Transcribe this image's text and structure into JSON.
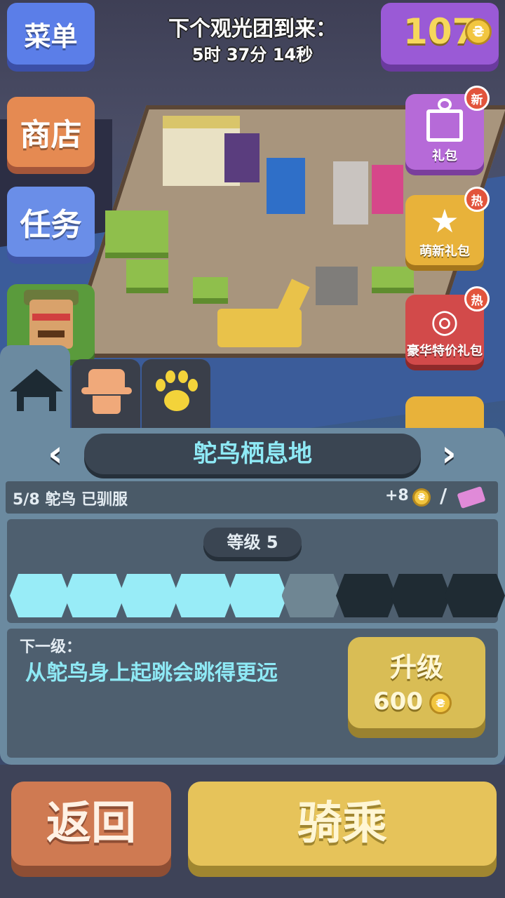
{
  "hud": {
    "menu_label": "菜单",
    "shop_label": "商店",
    "tasks_label": "任务",
    "tour_title": "下个观光团到来：",
    "tour_countdown": "5时 37分 14秒",
    "coins": "107",
    "coin_symbol": "₴"
  },
  "offers": [
    {
      "label": "礼包",
      "badge": "新",
      "icon": "gift-box-icon"
    },
    {
      "label": "萌新礼包",
      "badge": "热",
      "icon": "star-badge-icon"
    },
    {
      "label": "豪华特价礼包",
      "badge": "热",
      "icon": "coin-bundle-icon"
    }
  ],
  "tabs": {
    "home_icon": "home-icon",
    "keeper_icon": "cowboy-hat-icon",
    "animal_icon": "paw-icon"
  },
  "habitat": {
    "name": "鸵鸟栖息地",
    "prev_arrow": "‹",
    "next_arrow": "›",
    "tamed_status": "5/8 鸵鸟 已驯服",
    "income": "+8",
    "slash": "/",
    "level_label": "等级 5",
    "level_progress": {
      "filled": 5,
      "current": 1,
      "total": 9
    },
    "next_level_label": "下一级：",
    "next_level_desc": "从鸵鸟身上起跳会跳得更远",
    "upgrade_label": "升级",
    "upgrade_cost": "600"
  },
  "actions": {
    "back_label": "返回",
    "ride_label": "骑乘"
  },
  "colors": {
    "cyan_text": "#8ee9f5",
    "panel": "#6b8aa0",
    "coin_purple": "#9a5ad6",
    "upgrade_gold": "#d9bd55"
  }
}
